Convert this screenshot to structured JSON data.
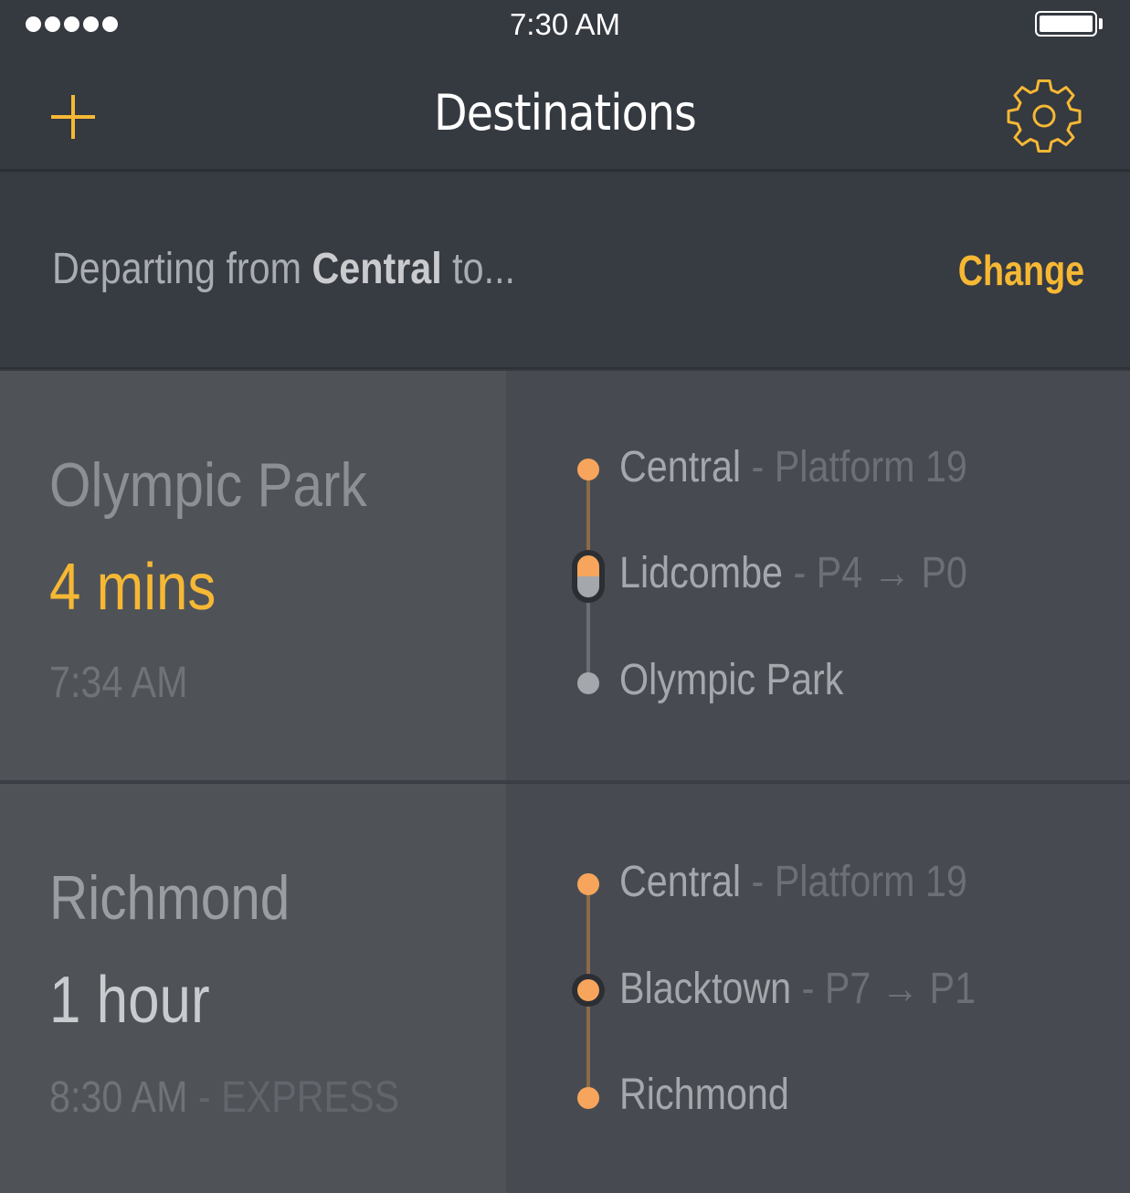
{
  "status_bar": {
    "time": "7:30 AM",
    "signal_icon": "signal-dots-icon",
    "battery_icon": "battery-icon"
  },
  "nav": {
    "title": "Destinations",
    "add_icon": "plus-icon",
    "settings_icon": "gear-icon"
  },
  "departing": {
    "prefix": "Departing from ",
    "station": "Central",
    "suffix": " to...",
    "change_label": "Change"
  },
  "colors": {
    "accent": "#f6b834",
    "stop_orange": "#f7a55c",
    "stop_gray": "#a4a8ad",
    "line_orange": "#8a6a4a",
    "line_gray": "#6a6e74"
  },
  "destinations": [
    {
      "name": "Olympic Park",
      "eta": "4 mins",
      "time": "7:34 AM",
      "service": "",
      "stops": [
        {
          "name": "Central",
          "detail": "- Platform 19"
        },
        {
          "name": "Lidcombe",
          "detail": "- P4 → P0"
        },
        {
          "name": "Olympic Park",
          "detail": ""
        }
      ]
    },
    {
      "name": "Richmond",
      "eta": "1 hour",
      "time": "8:30 AM",
      "service": "- EXPRESS",
      "stops": [
        {
          "name": "Central",
          "detail": "- Platform 19"
        },
        {
          "name": "Blacktown",
          "detail": "- P7 → P1"
        },
        {
          "name": "Richmond",
          "detail": ""
        }
      ]
    }
  ]
}
